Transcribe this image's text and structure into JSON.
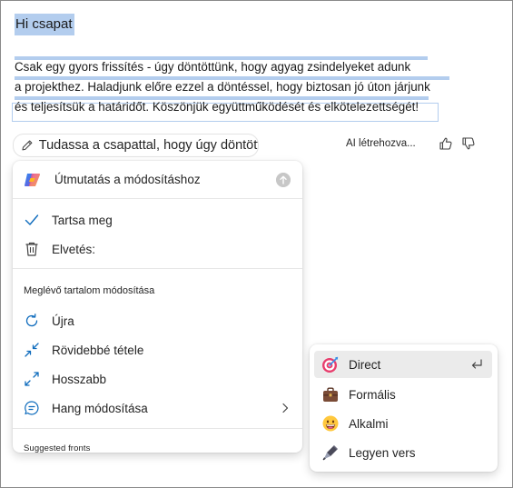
{
  "document": {
    "title": "Hi csapat",
    "lines": [
      "Csak egy gyors frissítés - úgy döntöttünk, hogy agyag zsindelyeket adunk",
      "a projekthez. Haladjunk előre ezzel a döntéssel, hogy biztosan jó úton járjunk",
      "és teljesítsük a határidőt. Köszönjük együttműködését és elkötelezettségét!"
    ]
  },
  "toolbar": {
    "prompt_text": "Tudassa a csapattal, hogy úgy döntöttünk...",
    "ai_label": "AI létrehozva...",
    "icons": {
      "pencil": "pencil-icon",
      "like": "thumbs-up-icon",
      "dislike": "thumbs-down-icon"
    }
  },
  "menu": {
    "header": "Útmutatás a módosításhoz",
    "keep": "Tartsa meg",
    "discard": "Elvetés:",
    "section_label": "Meglévő tartalom módosítása",
    "regenerate": "Újra",
    "shorten": "Rövidebbé tétele",
    "lengthen": "Hosszabb",
    "change_tone": "Hang módosítása",
    "suggested": "Suggested fronts"
  },
  "submenu": {
    "items": [
      {
        "label": "Direct",
        "icon": "target-icon",
        "selected": true
      },
      {
        "label": "Formális",
        "icon": "briefcase-icon",
        "selected": false
      },
      {
        "label": "Alkalmi",
        "icon": "grinning-face-icon",
        "selected": false
      },
      {
        "label": "Legyen vers",
        "icon": "fountain-pen-icon",
        "selected": false
      }
    ]
  },
  "colors": {
    "selection": "#b3cdee",
    "accent": "#0f6cbd",
    "icon": "#424242",
    "hover": "#ebebeb"
  }
}
